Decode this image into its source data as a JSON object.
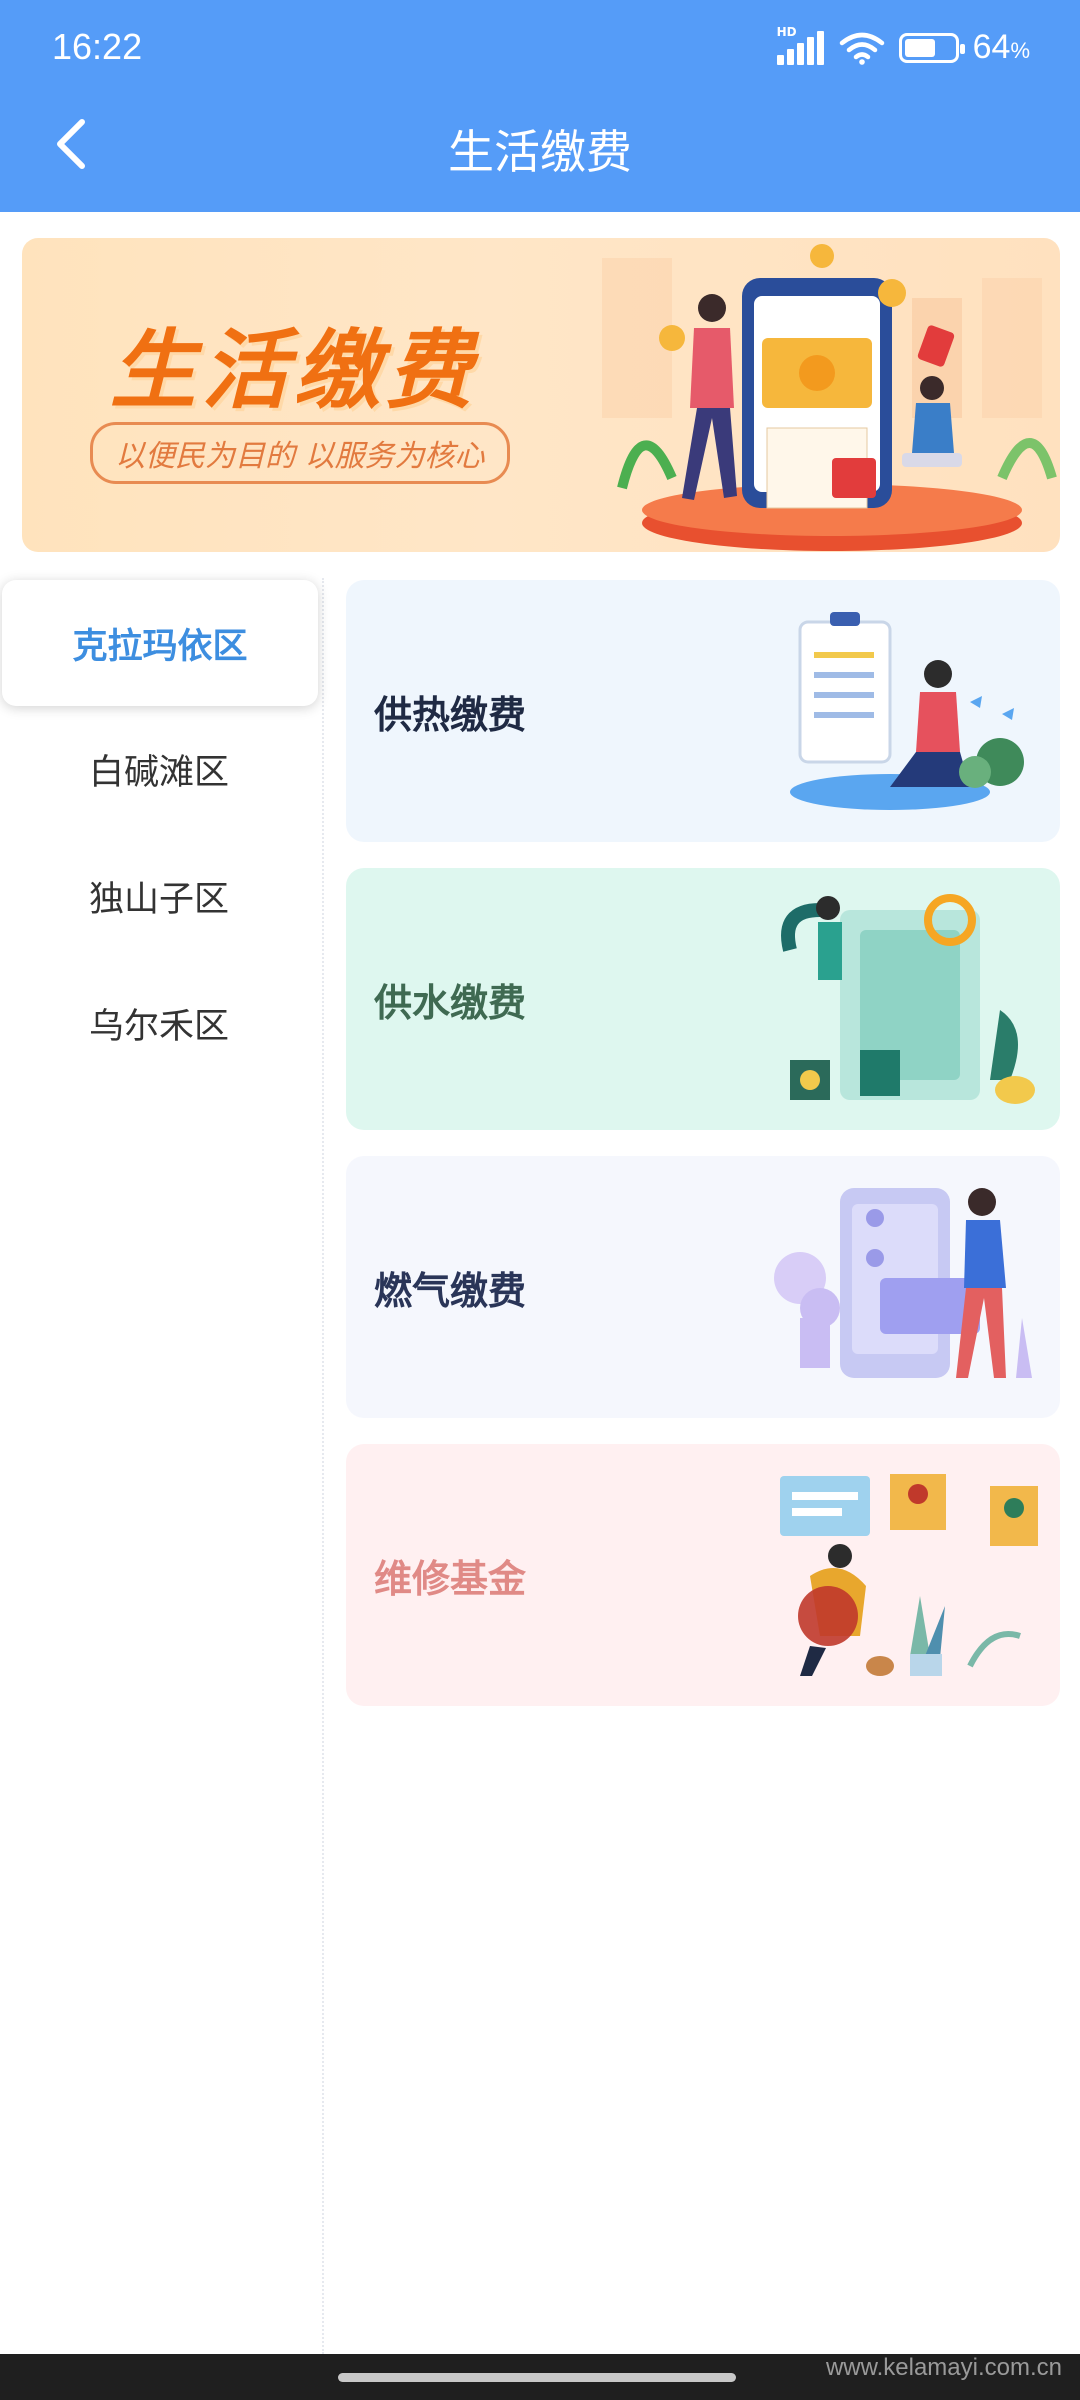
{
  "status_bar": {
    "time": "16:22",
    "network_badge": "HD",
    "battery_percent": "64",
    "battery_unit": "%",
    "battery_level": 0.64,
    "icons": [
      "signal-icon",
      "wifi-icon",
      "battery-icon"
    ]
  },
  "header": {
    "title": "生活缴费",
    "back_icon": "chevron-left-icon",
    "background": "#559cf8"
  },
  "banner": {
    "title": "生活缴费",
    "subtitle": "以便民为目的 以服务为核心"
  },
  "sidebar": {
    "items": [
      {
        "label": "克拉玛依区",
        "active": true
      },
      {
        "label": "白碱滩区",
        "active": false
      },
      {
        "label": "独山子区",
        "active": false
      },
      {
        "label": "乌尔禾区",
        "active": false
      }
    ],
    "active_color": "#3d8ee0"
  },
  "services": [
    {
      "label": "供热缴费",
      "color": "#1f2a44",
      "bg": "#eff6fd"
    },
    {
      "label": "供水缴费",
      "color": "#3f6a52",
      "bg": "#def7ef"
    },
    {
      "label": "燃气缴费",
      "color": "#2a3558",
      "bg": "#f5f7fd"
    },
    {
      "label": "维修基金",
      "color": "#e08a86",
      "bg": "#fff0f1"
    }
  ],
  "footer": {
    "watermark": "www.kelamayi.com.cn"
  }
}
